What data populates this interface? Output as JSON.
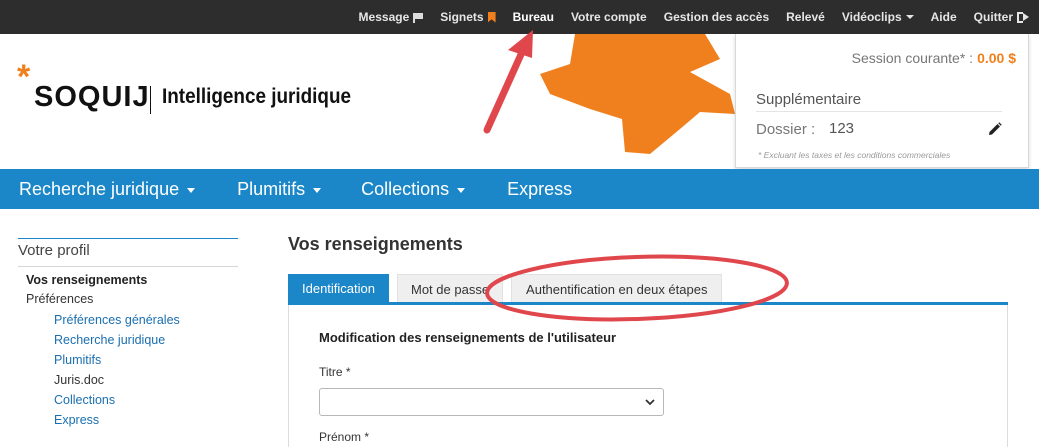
{
  "topnav": {
    "items": [
      {
        "label": "Message",
        "icon": "flag-icon"
      },
      {
        "label": "Signets",
        "icon": "bookmark-icon"
      },
      {
        "label": "Bureau",
        "icon": ""
      },
      {
        "label": "Votre compte",
        "icon": ""
      },
      {
        "label": "Gestion des accès",
        "icon": ""
      },
      {
        "label": "Relevé",
        "icon": ""
      },
      {
        "label": "Vidéoclips",
        "icon": "caret-down-icon"
      },
      {
        "label": "Aide",
        "icon": ""
      },
      {
        "label": "Quitter",
        "icon": "sign-out-icon"
      }
    ],
    "active_label": "Bureau"
  },
  "brand": {
    "star": "*",
    "name": "SOQUIJ",
    "tagline": "Intelligence juridique",
    "accent_color": "#f0801e"
  },
  "session": {
    "label": "Session courante* :",
    "amount": "0.00 $",
    "extra_title": "Supplémentaire",
    "dossier_label": "Dossier :",
    "dossier_value": "123",
    "note": "* Excluant les taxes et les conditions commerciales"
  },
  "mainnav": {
    "items": [
      {
        "label": "Recherche juridique",
        "dropdown": true
      },
      {
        "label": "Plumitifs",
        "dropdown": true
      },
      {
        "label": "Collections",
        "dropdown": true
      },
      {
        "label": "Express",
        "dropdown": false
      }
    ],
    "color": "#1b87c9"
  },
  "sidebar": {
    "title": "Votre profil",
    "current": "Vos renseignements",
    "group": "Préférences",
    "sub_items": [
      {
        "label": "Préférences générales",
        "link": true
      },
      {
        "label": "Recherche juridique",
        "link": true
      },
      {
        "label": "Plumitifs",
        "link": true
      },
      {
        "label": "Juris.doc",
        "link": false
      },
      {
        "label": "Collections",
        "link": true
      },
      {
        "label": "Express",
        "link": true
      }
    ]
  },
  "content": {
    "title": "Vos renseignements",
    "tabs": [
      {
        "label": "Identification",
        "active": true
      },
      {
        "label": "Mot de passe",
        "active": false
      },
      {
        "label": "Authentification en deux étapes",
        "active": false
      }
    ],
    "form_title": "Modification des renseignements de l'utilisateur",
    "fields": [
      {
        "label": "Titre *",
        "value": ""
      },
      {
        "label": "Prénom *",
        "value": ""
      }
    ]
  },
  "annotation_color": "#e0474c"
}
